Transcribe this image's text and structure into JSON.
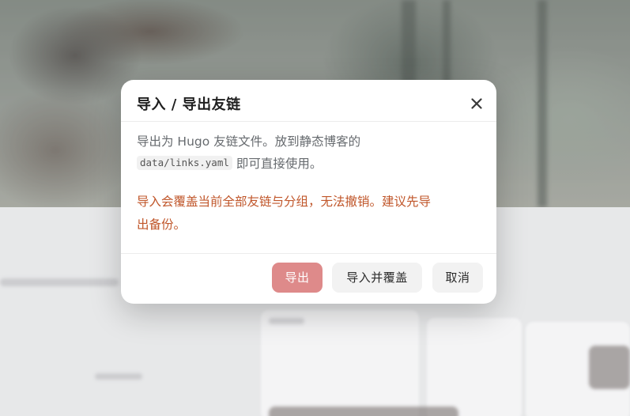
{
  "dialog": {
    "title": "导入 / 导出友链",
    "body_line1": "导出为 Hugo 友链文件。放到静态博客的",
    "code_path": "data/links.yaml",
    "body_line2_suffix": " 即可直接使用。",
    "warning_line1": "导入会覆盖当前全部友链与分组，无法撤销。建议先导",
    "warning_line2": "出备份。",
    "close_icon": "close-icon"
  },
  "buttons": {
    "export_label": "导出",
    "import_label": "导入并覆盖",
    "cancel_label": "取消"
  },
  "colors": {
    "export_button": "#de8a8a",
    "warning_text": "#c0562a",
    "secondary_button": "#f2f2f2"
  }
}
